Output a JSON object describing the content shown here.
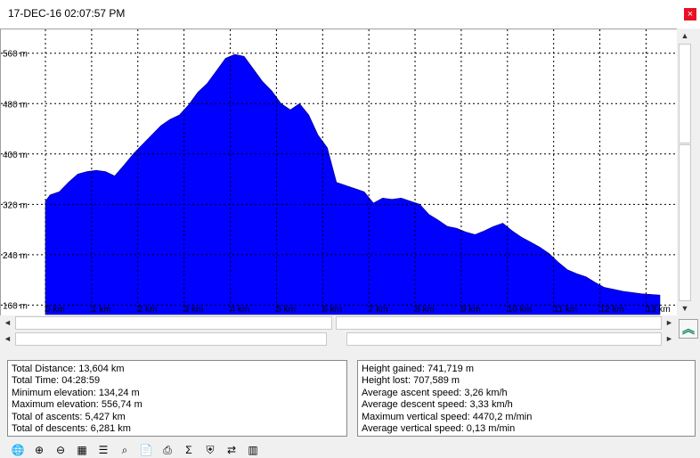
{
  "window": {
    "title": "17-DEC-16 02:07:57 PM",
    "close_glyph": "×"
  },
  "chart_data": {
    "type": "area",
    "title": "",
    "xlabel": "",
    "ylabel": "",
    "x_unit": "km",
    "y_unit": "m",
    "xlim": [
      0,
      13.3
    ],
    "ylim": [
      145,
      595
    ],
    "x_ticks": [
      "0 km",
      "1 km",
      "2 km",
      "3 km",
      "4 km",
      "5 km",
      "6 km",
      "7 km",
      "8 km",
      "9 km",
      "10 km",
      "11 km",
      "12 km",
      "13 km"
    ],
    "x_tick_values": [
      0,
      1,
      2,
      3,
      4,
      5,
      6,
      7,
      8,
      9,
      10,
      11,
      12,
      13
    ],
    "y_ticks": [
      "160 m",
      "240 m",
      "320 m",
      "400 m",
      "480 m",
      "560 m"
    ],
    "y_tick_values": [
      160,
      240,
      320,
      400,
      480,
      560
    ],
    "grid": true,
    "fill_color": "#0000ff",
    "x": [
      0,
      0.1,
      0.3,
      0.5,
      0.7,
      0.9,
      1.1,
      1.3,
      1.5,
      1.7,
      1.9,
      2.1,
      2.3,
      2.5,
      2.7,
      2.9,
      3.1,
      3.3,
      3.5,
      3.7,
      3.9,
      4.1,
      4.3,
      4.5,
      4.7,
      4.9,
      5.1,
      5.3,
      5.5,
      5.7,
      5.9,
      6.1,
      6.3,
      6.5,
      6.7,
      6.9,
      7.1,
      7.3,
      7.5,
      7.7,
      7.9,
      8.1,
      8.3,
      8.5,
      8.7,
      8.9,
      9.1,
      9.3,
      9.5,
      9.7,
      9.9,
      10.1,
      10.3,
      10.5,
      10.7,
      10.9,
      11.1,
      11.3,
      11.5,
      11.7,
      11.9,
      12.1,
      12.3,
      12.5,
      12.7,
      12.9,
      13.1,
      13.3
    ],
    "y": [
      325,
      335,
      340,
      355,
      368,
      372,
      374,
      372,
      365,
      382,
      400,
      415,
      430,
      445,
      455,
      462,
      478,
      498,
      512,
      532,
      552,
      558,
      555,
      535,
      515,
      500,
      480,
      470,
      480,
      462,
      430,
      410,
      355,
      350,
      345,
      340,
      322,
      330,
      328,
      330,
      325,
      320,
      304,
      295,
      285,
      282,
      276,
      272,
      278,
      285,
      290,
      278,
      268,
      260,
      252,
      242,
      228,
      216,
      210,
      205,
      196,
      188,
      185,
      182,
      180,
      178,
      177,
      176
    ]
  },
  "scroll": {
    "up": "▲",
    "down": "▼",
    "left": "◄",
    "right": "►"
  },
  "collapse_button": {
    "glyph": "︽"
  },
  "stats_left": [
    "Total Distance: 13,604 km",
    "Total Time: 04:28:59",
    "Minimum elevation: 134,24 m",
    "Maximum elevation: 556,74 m",
    "Total of ascents: 5,427 km",
    "Total of descents: 6,281 km"
  ],
  "stats_right": [
    "Height gained: 741,719 m",
    "Height lost: 707,589 m",
    "Average ascent speed: 3,26 km/h",
    "Average descent speed: 3,33 km/h",
    "Maximum vertical speed: 4470,2 m/min",
    "Average vertical speed: 0,13 m/min"
  ],
  "toolbar": {
    "buttons": [
      {
        "name": "globe-icon",
        "glyph": "🌐"
      },
      {
        "name": "zoom-in-icon",
        "glyph": "⊕"
      },
      {
        "name": "zoom-out-icon",
        "glyph": "⊖"
      },
      {
        "name": "grid-icon",
        "glyph": "▦"
      },
      {
        "name": "list-icon",
        "glyph": "☰"
      },
      {
        "name": "zoom-fit-icon",
        "glyph": "⌕"
      },
      {
        "name": "document-icon",
        "glyph": "📄"
      },
      {
        "name": "print-icon",
        "glyph": "⎙"
      },
      {
        "name": "sum-icon",
        "glyph": "Σ"
      },
      {
        "name": "shield-icon",
        "glyph": "⛨"
      },
      {
        "name": "swap-icon",
        "glyph": "⇄"
      },
      {
        "name": "export-icon",
        "glyph": "▥"
      }
    ]
  }
}
